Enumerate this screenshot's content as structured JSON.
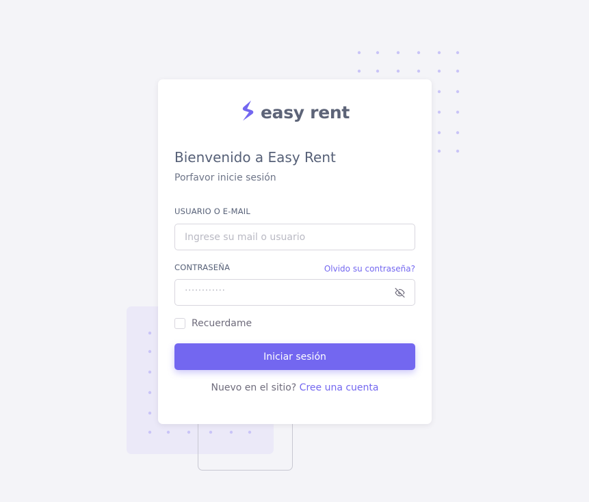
{
  "colors": {
    "accent": "#7367f0",
    "background": "#f4f4f8",
    "card": "#ffffff",
    "text_heading": "#566077",
    "text_body": "#6e6b7b"
  },
  "brand": {
    "name": "easy rent",
    "logo_icon": "s-bolt-logo-icon"
  },
  "header": {
    "title": "Bienvenido a Easy Rent",
    "subtitle": "Porfavor inicie sesión"
  },
  "form": {
    "user": {
      "label": "USUARIO O E-MAIL",
      "placeholder": "Ingrese su mail o usuario",
      "value": ""
    },
    "password": {
      "label": "CONTRASEÑA",
      "forgot_link": "Olvido su contraseña?",
      "masked_value": "············",
      "toggle_icon": "eye-off-icon"
    },
    "remember": {
      "label": "Recuerdame",
      "checked": false
    },
    "submit_label": "Iniciar sesión"
  },
  "footer": {
    "prompt": "Nuevo en el sitio?",
    "link": "Cree una cuenta"
  }
}
